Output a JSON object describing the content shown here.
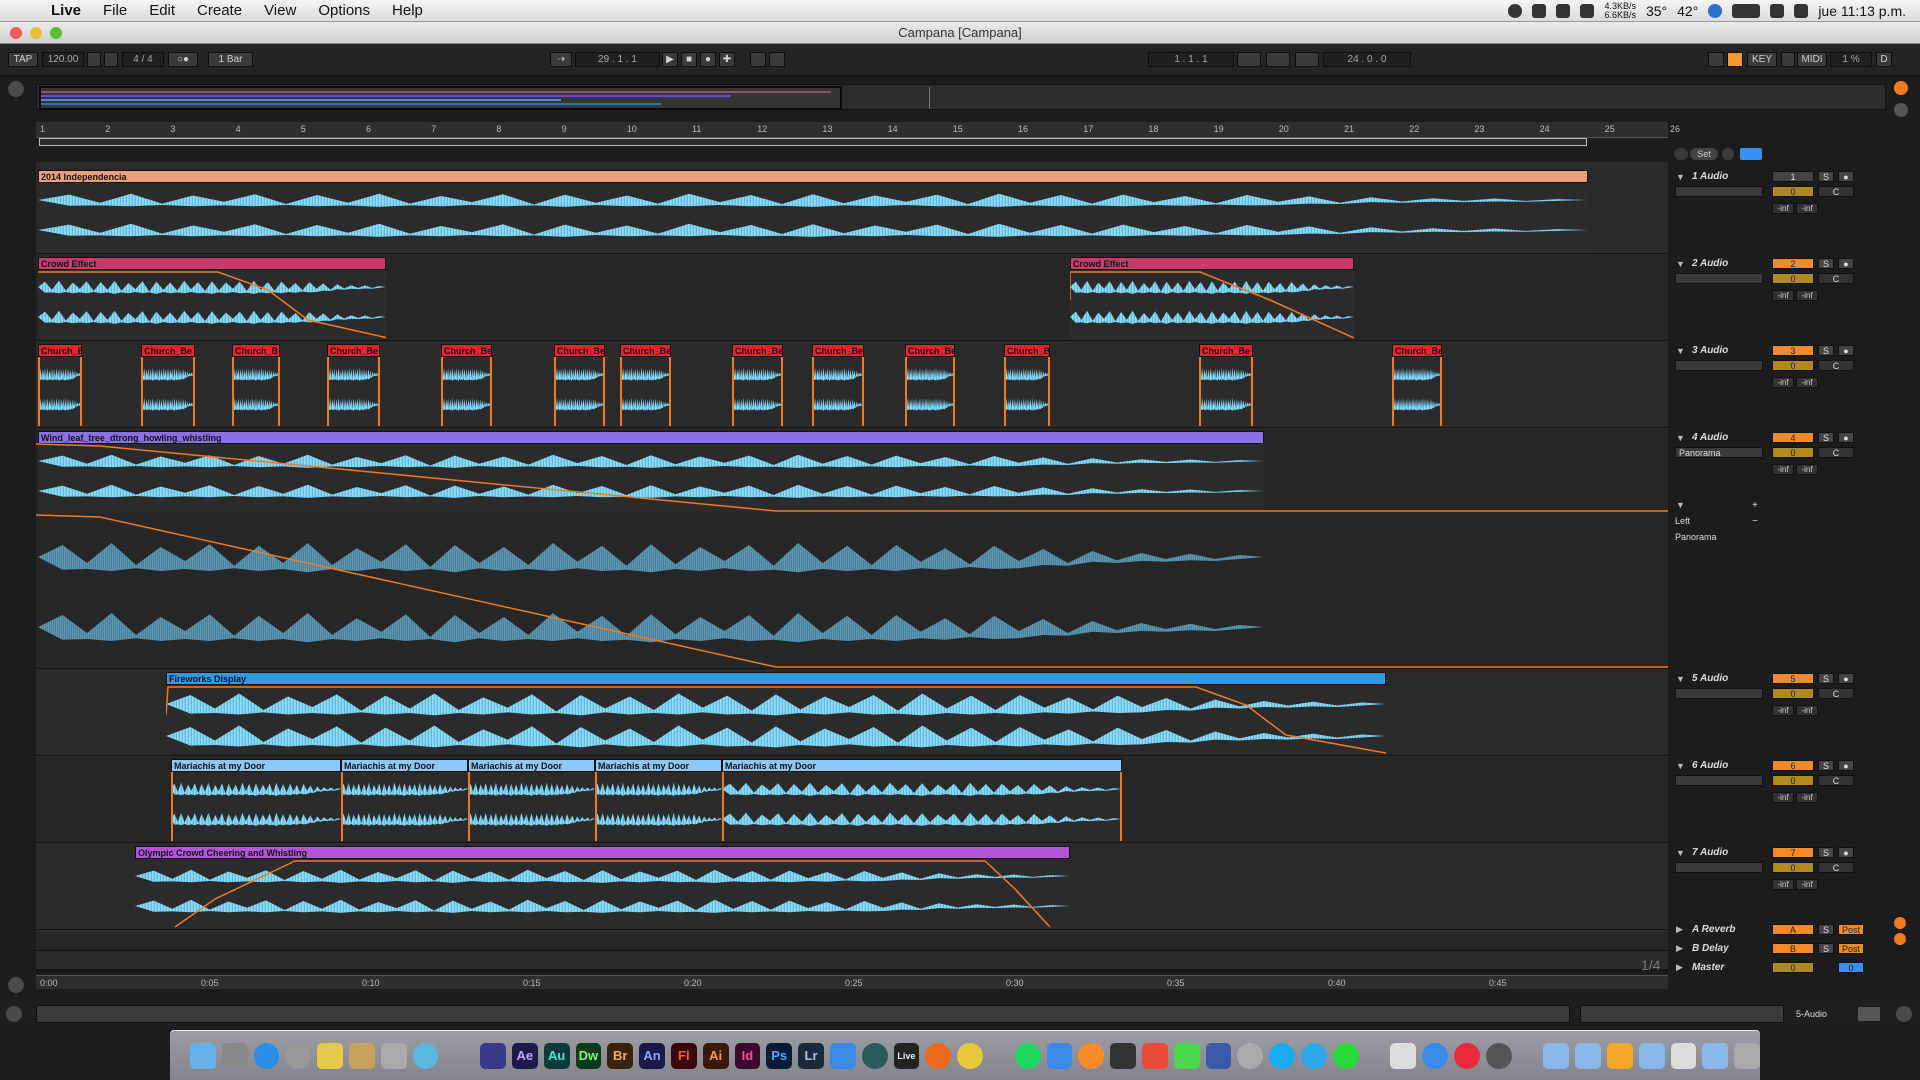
{
  "menubar": {
    "app": "Live",
    "items": [
      "File",
      "Edit",
      "Create",
      "View",
      "Options",
      "Help"
    ],
    "net_up": "4.3KB/s",
    "net_down": "6.6KB/s",
    "temp": "35°",
    "temp2": "42°",
    "clock": "jue 11:13 p.m."
  },
  "window": {
    "title": "Campana  [Campana]"
  },
  "control": {
    "tap": "TAP",
    "tempo": "120.00",
    "signature": "4 / 4",
    "quantize": "1 Bar",
    "position": "29 .  1 .  1",
    "loop_start": "1 .  1 .  1",
    "loop_length": "24 .  0 .  0",
    "key": "KEY",
    "midi": "MIDI",
    "cpu": "1 %",
    "d": "D"
  },
  "ruler": [
    "1",
    "2",
    "3",
    "4",
    "5",
    "6",
    "7",
    "8",
    "9",
    "10",
    "11",
    "12",
    "13",
    "14",
    "15",
    "16",
    "17",
    "18",
    "19",
    "20",
    "21",
    "22",
    "23",
    "24",
    "25",
    "26"
  ],
  "timeline": [
    "0:00",
    "0:05",
    "0:10",
    "0:15",
    "0:20",
    "0:25",
    "0:30",
    "0:35",
    "0:40",
    "0:45"
  ],
  "set_button": "Set",
  "tracks": [
    {
      "name": "1 Audio",
      "number": "1",
      "color": "#e9b48f",
      "input": "",
      "clips": [
        {
          "label": "2014 Independencia"
        }
      ]
    },
    {
      "name": "2 Audio",
      "number": "2",
      "color": "#f08a2a",
      "input": "",
      "clips": [
        {
          "label": "Crowd Effect"
        },
        {
          "label": "Crowd Effect"
        }
      ]
    },
    {
      "name": "3 Audio",
      "number": "3",
      "color": "#f08a2a",
      "input": "",
      "clips": [
        {
          "label": "Church_B"
        },
        {
          "label": "Church_Be"
        },
        {
          "label": "Church_B"
        },
        {
          "label": "Church_Be"
        },
        {
          "label": "Church_Be"
        },
        {
          "label": "Church_Be"
        },
        {
          "label": "Church_Be"
        },
        {
          "label": "Church_Be"
        },
        {
          "label": "Church_Be"
        },
        {
          "label": "Church_Be"
        },
        {
          "label": "Church_B"
        },
        {
          "label": "Church_Be"
        },
        {
          "label": "Church_Be"
        }
      ]
    },
    {
      "name": "4 Audio",
      "number": "4",
      "color": "#f08a2a",
      "input": "Panorama",
      "clips": [
        {
          "label": "Wind_leaf_tree_dtrong_howling_whistling"
        }
      ],
      "lane_param": "Left",
      "lane_device": "Panorama"
    },
    {
      "name": "5 Audio",
      "number": "5",
      "color": "#f08a2a",
      "input": "",
      "clips": [
        {
          "label": "Fireworks Display"
        }
      ]
    },
    {
      "name": "6 Audio",
      "number": "6",
      "color": "#f08a2a",
      "input": "",
      "clips": [
        {
          "label": "Mariachis at my Door"
        },
        {
          "label": "Mariachis at my Door"
        },
        {
          "label": "Mariachis at my Door"
        },
        {
          "label": "Mariachis at my Door"
        },
        {
          "label": "Mariachis at my Door"
        }
      ]
    },
    {
      "name": "7 Audio",
      "number": "7",
      "color": "#f08a2a",
      "input": "",
      "clips": [
        {
          "label": "Olympic Crowd Cheering and  Whistling"
        }
      ]
    }
  ],
  "track_controls": {
    "solo": "S",
    "vol": "0",
    "pan": "C",
    "inf": "-inf"
  },
  "returns": [
    {
      "name": "A Reverb",
      "letter": "A",
      "post": "Post"
    },
    {
      "name": "B Delay",
      "letter": "B",
      "post": "Post"
    },
    {
      "name": "Master",
      "letter": "0",
      "post": "0"
    }
  ],
  "page_indicator": "1/4",
  "status": {
    "track_selected": "5-Audio"
  },
  "dock": [
    "Ae",
    "Au",
    "Dw",
    "Br",
    "An",
    "Fl",
    "Ai",
    "Id",
    "Ps",
    "Lr",
    "Live"
  ]
}
